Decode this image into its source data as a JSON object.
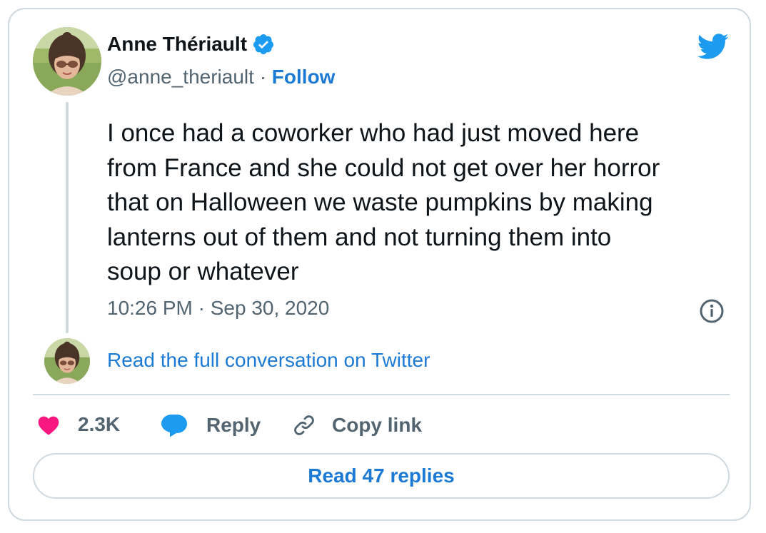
{
  "tweet": {
    "author": {
      "display_name": "Anne Thériault",
      "handle": "@anne_theriault",
      "separator": "·",
      "follow_label": "Follow",
      "verified": true
    },
    "text": "I once had a coworker who had just moved here\nfrom France and she could not get over her horror\nthat on Halloween we waste pumpkins by making\nlanterns out of them and not turning them into\nsoup or whatever",
    "timestamp": "10:26 PM · Sep 30, 2020",
    "read_conversation_label": "Read the full conversation on Twitter",
    "actions": {
      "like_count": "2.3K",
      "reply_label": "Reply",
      "copy_link_label": "Copy link"
    },
    "read_replies_label": "Read 47 replies"
  },
  "icons": {
    "brand": "twitter-bird-icon",
    "verified": "verified-badge-icon",
    "info": "info-icon",
    "like": "heart-icon",
    "reply": "speech-bubble-icon",
    "copy": "link-icon"
  },
  "colors": {
    "brand_blue": "#1d9bf0",
    "link_blue": "#1d7ad4",
    "like_pink": "#f91880",
    "text_primary": "#0f1419",
    "text_secondary": "#536471",
    "border": "#cfd9de"
  }
}
